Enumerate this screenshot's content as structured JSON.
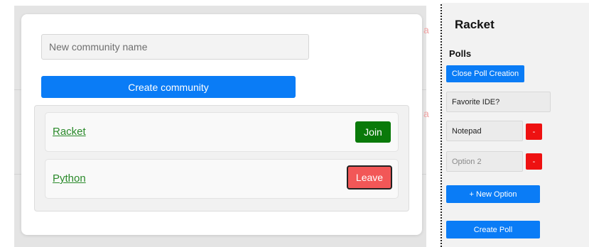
{
  "modal": {
    "name_placeholder": "New community name",
    "create_label": "Create community",
    "communities": [
      {
        "name": "Racket",
        "action": "Join"
      },
      {
        "name": "Python",
        "action": "Leave"
      }
    ]
  },
  "background": {
    "fragment": "a"
  },
  "poll_panel": {
    "community_title": "Racket",
    "polls_heading": "Polls",
    "close_label": "Close Poll Creation",
    "question_value": "Favorite IDE?",
    "options": [
      {
        "value": "Notepad",
        "placeholder": ""
      },
      {
        "value": "",
        "placeholder": "Option 2"
      }
    ],
    "remove_label": "-",
    "new_option_label": "+ New Option",
    "create_poll_label": "Create Poll"
  },
  "colors": {
    "primary": "#0a7cf6",
    "join": "#0a7a0a",
    "leave": "#f25757",
    "remove": "#ee1111",
    "link": "#2a8a2a"
  }
}
